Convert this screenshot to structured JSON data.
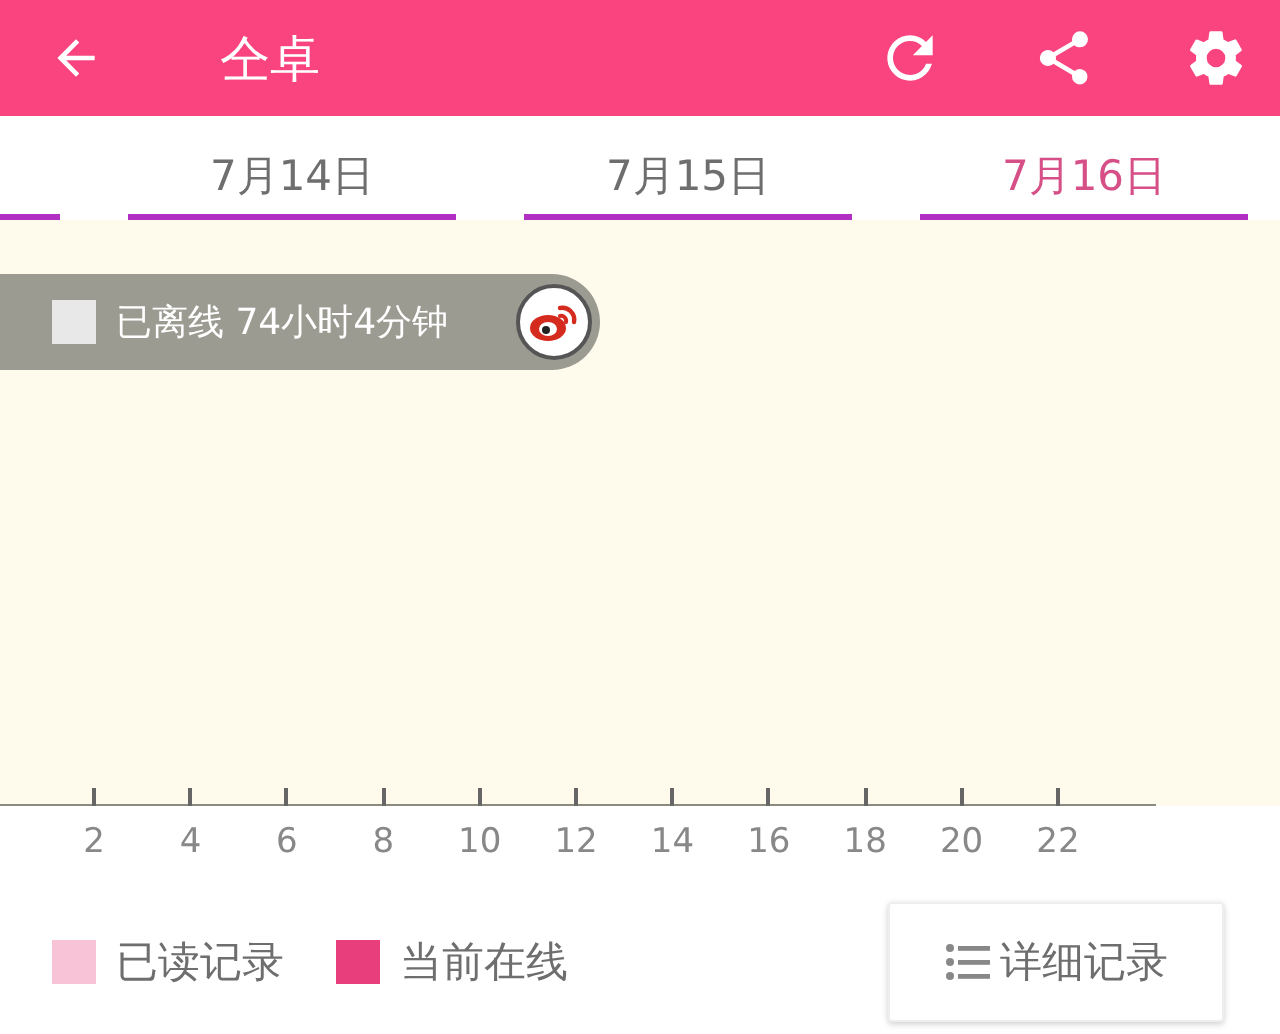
{
  "app_bar": {
    "title": "仝卓"
  },
  "tabs": [
    {
      "label": "7月14日",
      "selected": false
    },
    {
      "label": "7月15日",
      "selected": false
    },
    {
      "label": "7月16日",
      "selected": true
    }
  ],
  "status": {
    "checked": false,
    "text": "已离线 74小时4分钟"
  },
  "axis": {
    "ticks": [
      "2",
      "4",
      "6",
      "8",
      "10",
      "12",
      "14",
      "16",
      "18",
      "20",
      "22"
    ]
  },
  "legend": [
    {
      "label": "已读记录",
      "color": "#f8c3d7"
    },
    {
      "label": "当前在线",
      "color": "#e83e7c"
    }
  ],
  "detail_button": {
    "label": "详细记录"
  }
}
